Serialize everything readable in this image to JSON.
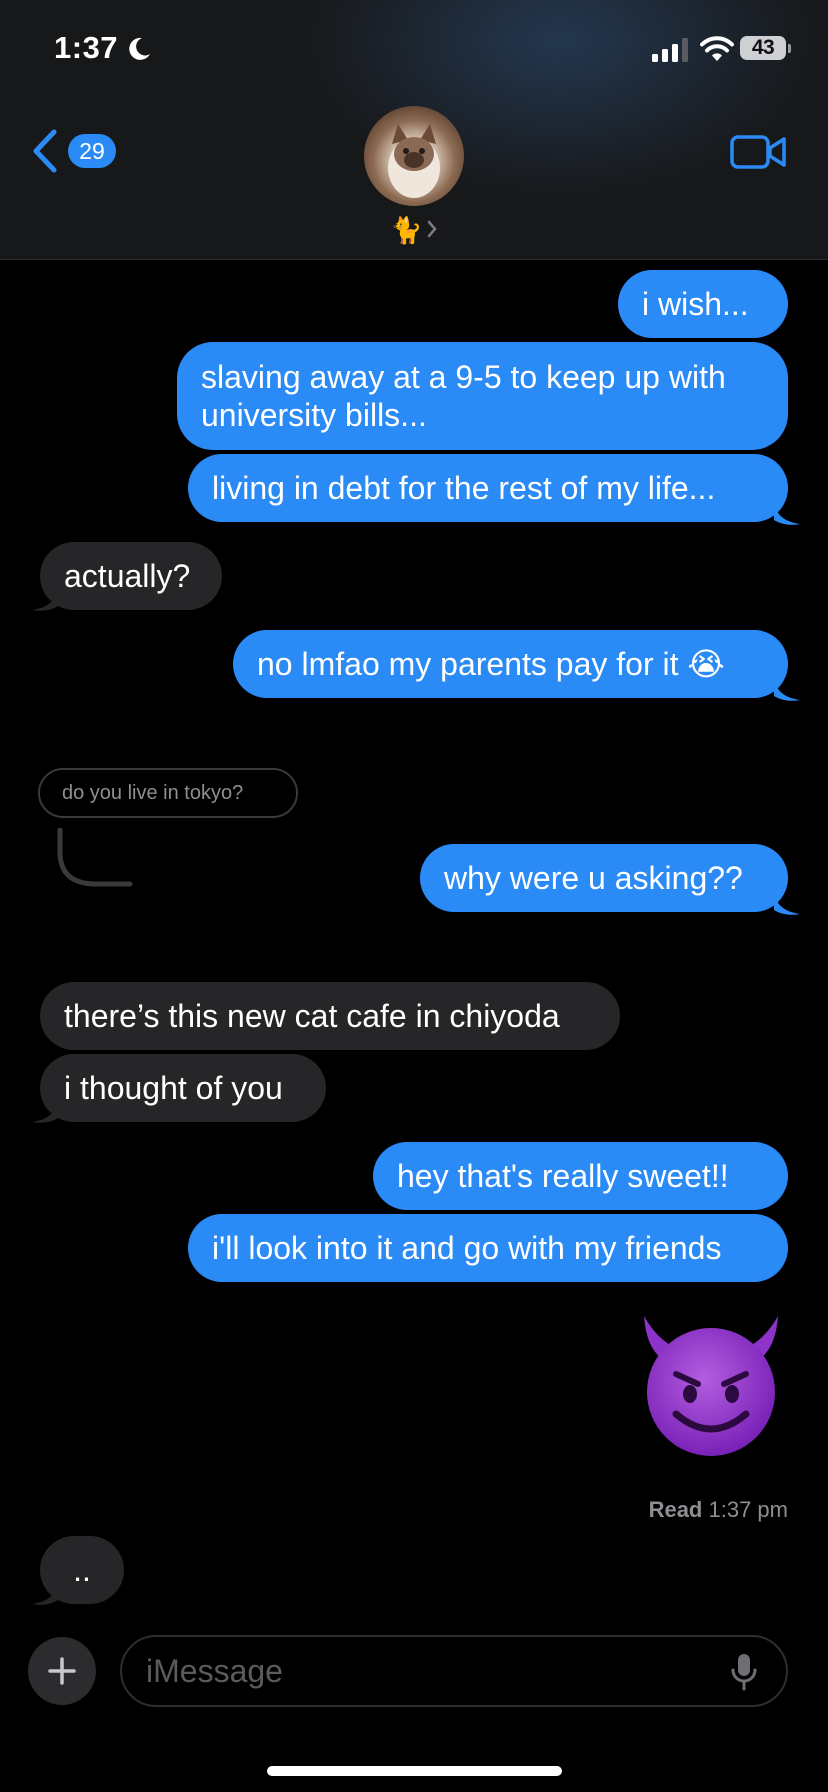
{
  "status_bar": {
    "time": "1:37",
    "battery": "43"
  },
  "header": {
    "back_count": "29",
    "contact_name": "🐈"
  },
  "messages": {
    "m1": "i wish...",
    "m2": "slaving away at a 9-5 to keep up with university bills...",
    "m3": "living in debt for the rest of my life...",
    "m4": "actually?",
    "m5": "no lmfao my parents pay for it 😭",
    "reply_context": "do you live in tokyo?",
    "m6": "why were u asking??",
    "m7": "there’s this new cat cafe in chiyoda",
    "m8": "i thought of you",
    "m9": "hey that's really sweet!!",
    "m10": "i'll look into it and go with my friends",
    "m11_emoji": "smiling-face-with-horns",
    "m12": ".."
  },
  "read_receipt": {
    "label": "Read",
    "time": "1:37 pm"
  },
  "input": {
    "placeholder": "iMessage"
  },
  "colors": {
    "outgoing": "#2a8af6",
    "incoming": "#262629",
    "accent": "#2a8af6",
    "background": "#000000"
  },
  "icons": [
    "moon-icon",
    "signal-icon",
    "wifi-icon",
    "battery-icon",
    "back-chevron-icon",
    "video-call-icon",
    "plus-icon",
    "microphone-icon"
  ]
}
